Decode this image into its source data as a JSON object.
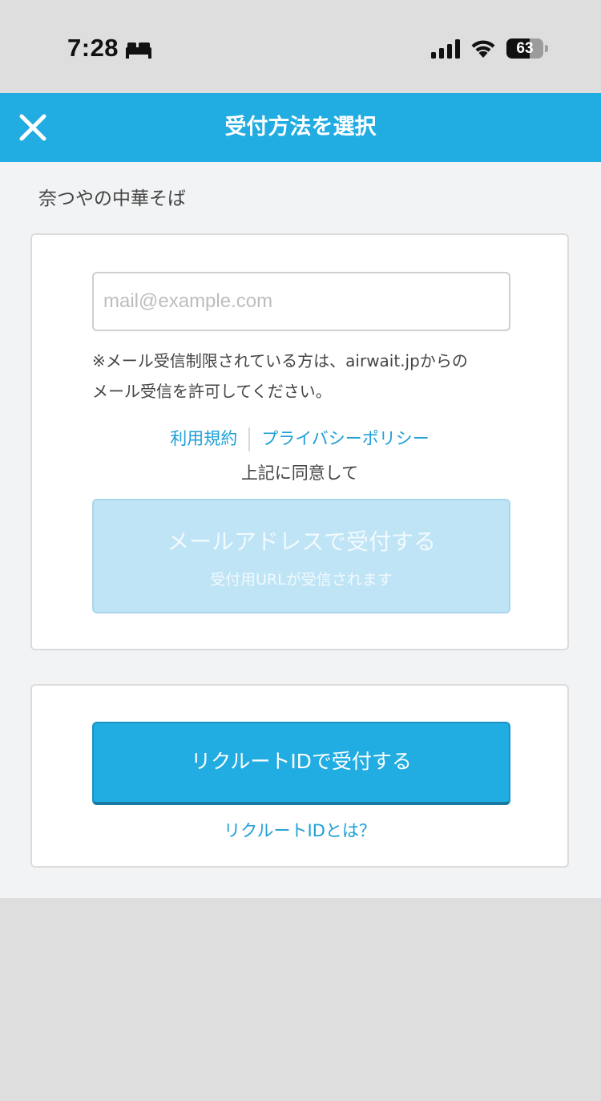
{
  "status_bar": {
    "time": "7:28",
    "focus_icon": "bed-icon",
    "signal_icon": "cellular-signal-icon",
    "wifi_icon": "wifi-icon",
    "battery_percent": 63,
    "battery_label": "63"
  },
  "header": {
    "title": "受付方法を選択",
    "close_icon": "close-icon",
    "background_color": "#21ace2"
  },
  "store": {
    "name": "奈つやの中華そば"
  },
  "email_card": {
    "email_placeholder": "mail@example.com",
    "email_value": "",
    "notice_line1": "※メール受信制限されている方は、airwait.jpからの",
    "notice_line2": "メール受信を許可してください。",
    "terms_link": "利用規約",
    "privacy_link": "プライバシーポリシー",
    "agree_text": "上記に同意して",
    "submit_label": "メールアドレスで受付する",
    "submit_sublabel": "受付用URLが受信されます"
  },
  "recruit_card": {
    "button_label": "リクルートIDで受付する",
    "help_link": "リクルートIDとは？"
  },
  "colors": {
    "accent": "#21ace2",
    "link": "#1e9fd6",
    "disabled_button": "#bfe4f6"
  }
}
